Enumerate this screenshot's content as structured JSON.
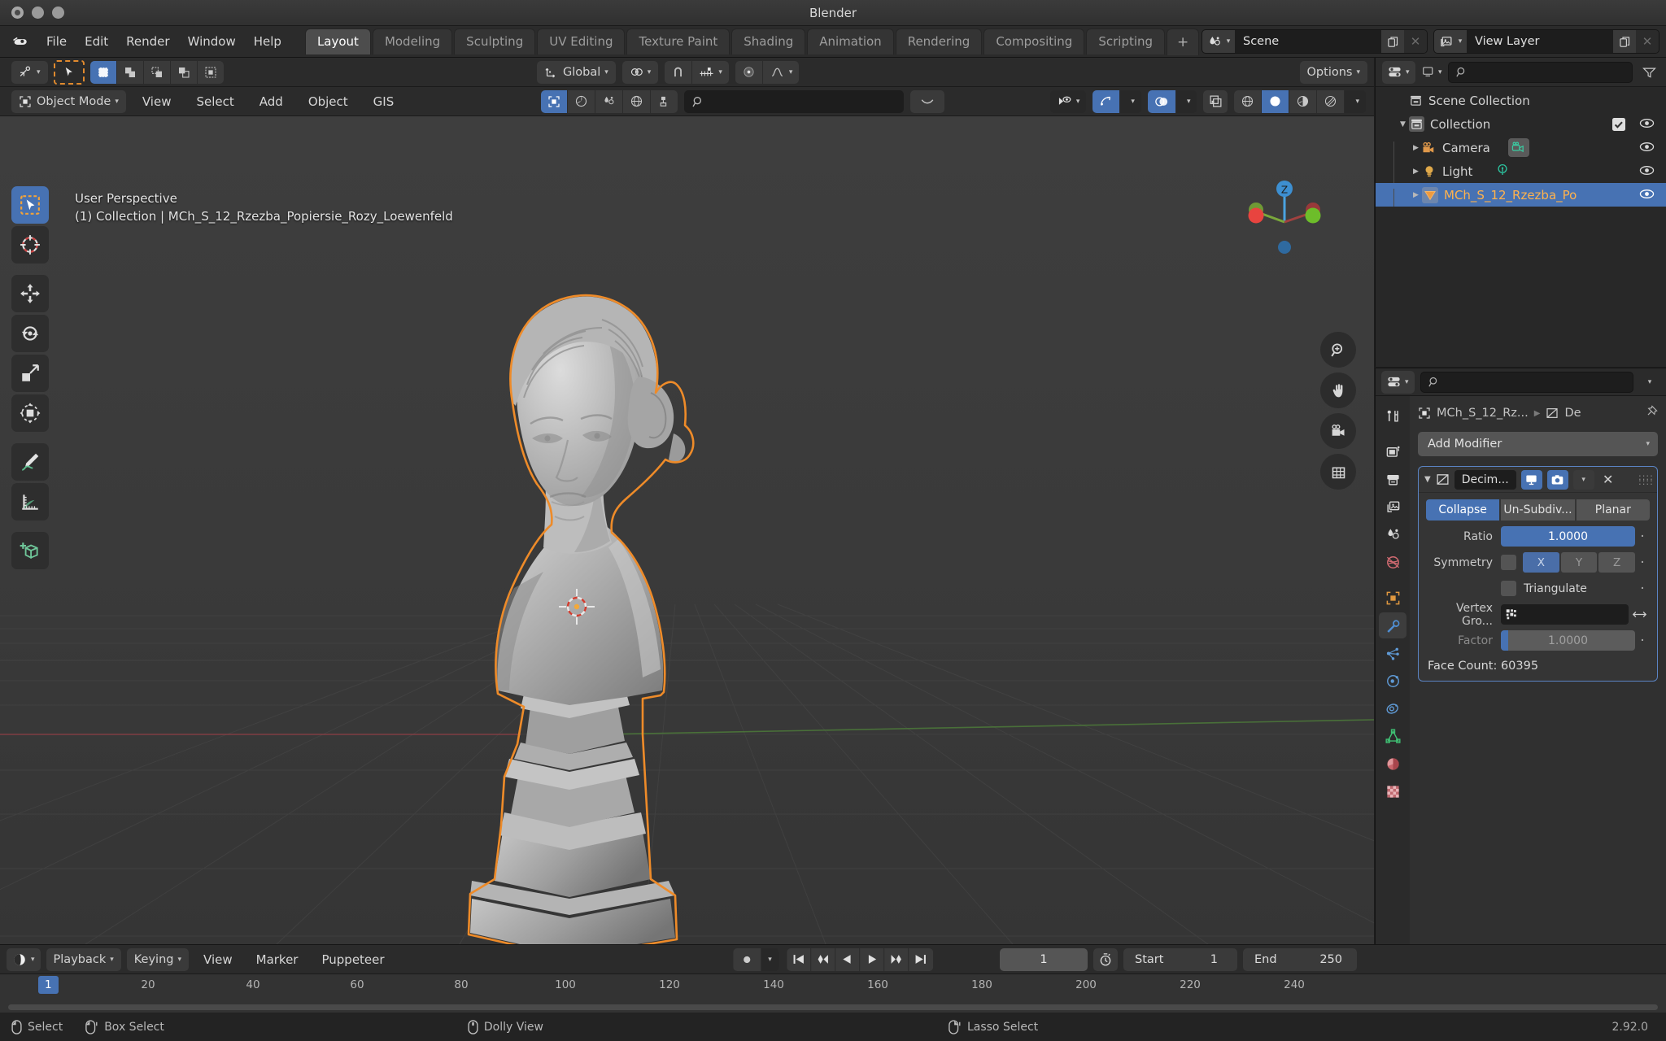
{
  "window": {
    "title": "Blender"
  },
  "topbar": {
    "menus": [
      "File",
      "Edit",
      "Render",
      "Window",
      "Help"
    ],
    "workspaces": [
      {
        "label": "Layout",
        "active": true
      },
      {
        "label": "Modeling",
        "active": false
      },
      {
        "label": "Sculpting",
        "active": false
      },
      {
        "label": "UV Editing",
        "active": false
      },
      {
        "label": "Texture Paint",
        "active": false
      },
      {
        "label": "Shading",
        "active": false
      },
      {
        "label": "Animation",
        "active": false
      },
      {
        "label": "Rendering",
        "active": false
      },
      {
        "label": "Compositing",
        "active": false
      },
      {
        "label": "Scripting",
        "active": false
      }
    ],
    "add_workspace": "+",
    "scene_name": "Scene",
    "view_layer_name": "View Layer"
  },
  "tool_header": {
    "transform_orientation": "Global",
    "options_label": "Options"
  },
  "viewport_header": {
    "mode": "Object Mode",
    "menus": [
      "View",
      "Select",
      "Add",
      "Object",
      "GIS"
    ]
  },
  "viewport": {
    "perspective_label": "User Perspective",
    "object_path": "(1) Collection | MCh_S_12_Rzezba_Popiersie_Rozy_Loewenfeld",
    "gizmo_axis_z": "Z",
    "tools": [
      {
        "name": "tweak-tool",
        "active": true
      },
      {
        "name": "cursor-tool",
        "active": false
      },
      {
        "name": "move-tool",
        "active": false
      },
      {
        "name": "rotate-tool",
        "active": false
      },
      {
        "name": "scale-tool",
        "active": false
      },
      {
        "name": "transform-tool",
        "active": false
      },
      {
        "name": "annotate-tool",
        "active": false
      },
      {
        "name": "measure-tool",
        "active": false
      },
      {
        "name": "add-cube-tool",
        "active": false
      }
    ]
  },
  "outliner": {
    "rows": [
      {
        "label": "Scene Collection",
        "depth": 0,
        "icon": "collection-icon",
        "has_disclosure": false,
        "selected": false,
        "eye": false,
        "check": false
      },
      {
        "label": "Collection",
        "depth": 1,
        "icon": "collection-icon",
        "has_disclosure": true,
        "expanded": true,
        "selected": false,
        "eye": true,
        "check": true
      },
      {
        "label": "Camera",
        "depth": 2,
        "icon": "camera-icon",
        "has_disclosure": true,
        "expanded": false,
        "selected": false,
        "eye": true,
        "check": false,
        "data_icon": "camera-data-icon"
      },
      {
        "label": "Light",
        "depth": 2,
        "icon": "light-icon",
        "has_disclosure": true,
        "expanded": false,
        "selected": false,
        "eye": true,
        "check": false,
        "data_icon": "light-data-icon"
      },
      {
        "label": "MCh_S_12_Rzezba_Po",
        "depth": 2,
        "icon": "mesh-icon",
        "has_disclosure": true,
        "expanded": false,
        "selected": true,
        "eye": true,
        "check": false
      }
    ]
  },
  "properties": {
    "breadcrumb_object": "MCh_S_12_Rz...",
    "breadcrumb_modifier": "De",
    "add_modifier_label": "Add Modifier",
    "tabs": [
      {
        "name": "tool-tab",
        "active": false
      },
      {
        "name": "render-tab",
        "active": false
      },
      {
        "name": "output-tab",
        "active": false
      },
      {
        "name": "view-layer-tab",
        "active": false
      },
      {
        "name": "scene-tab",
        "active": false
      },
      {
        "name": "world-tab",
        "active": false
      },
      {
        "name": "object-tab",
        "active": false
      },
      {
        "name": "modifier-tab",
        "active": true
      },
      {
        "name": "particles-tab",
        "active": false
      },
      {
        "name": "physics-tab",
        "active": false
      },
      {
        "name": "constraints-tab",
        "active": false
      },
      {
        "name": "object-data-tab",
        "active": false
      },
      {
        "name": "material-tab",
        "active": false
      },
      {
        "name": "texture-tab",
        "active": false
      }
    ],
    "modifier": {
      "name": "Decim...",
      "mode_buttons": [
        {
          "label": "Collapse",
          "active": true
        },
        {
          "label": "Un-Subdiv...",
          "active": false
        },
        {
          "label": "Planar",
          "active": false
        }
      ],
      "ratio_label": "Ratio",
      "ratio_value": "1.0000",
      "symmetry_label": "Symmetry",
      "symmetry_axes": [
        {
          "label": "X",
          "active": true
        },
        {
          "label": "Y",
          "active": false
        },
        {
          "label": "Z",
          "active": false
        }
      ],
      "triangulate_label": "Triangulate",
      "vertex_group_label": "Vertex Gro...",
      "factor_label": "Factor",
      "factor_value": "1.0000",
      "face_count": "Face Count: 60395"
    }
  },
  "timeline": {
    "menus": [
      "Playback",
      "Keying",
      "View",
      "Marker",
      "Puppeteer"
    ],
    "current_frame": "1",
    "start_label": "Start",
    "start_value": "1",
    "end_label": "End",
    "end_value": "250",
    "ticks": [
      "20",
      "40",
      "60",
      "80",
      "100",
      "120",
      "140",
      "160",
      "180",
      "200",
      "220",
      "240"
    ],
    "playhead_frame": "1"
  },
  "statusbar": {
    "items": [
      {
        "label": "Select",
        "icon": "mouse-left-icon"
      },
      {
        "label": "Box Select",
        "icon": "mouse-left-drag-icon"
      },
      {
        "label": "Dolly View",
        "icon": "mouse-middle-icon"
      },
      {
        "label": "Lasso Select",
        "icon": "mouse-right-drag-icon"
      }
    ],
    "version": "2.92.0"
  },
  "colors": {
    "accent_blue": "#4772b3",
    "selection_orange": "#ffb24d",
    "bg_dark": "#282828",
    "bg_panel": "#303030",
    "bg_header": "#2b2b2b"
  }
}
